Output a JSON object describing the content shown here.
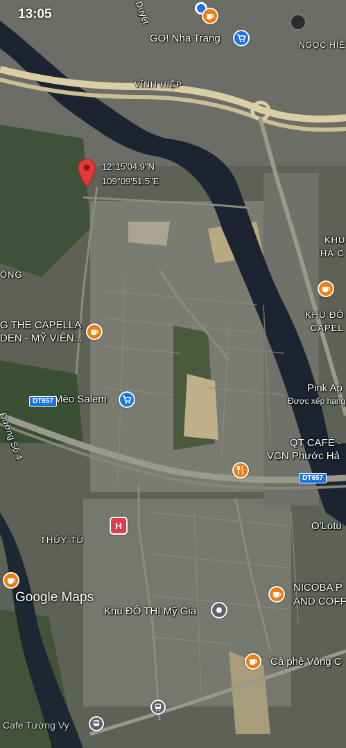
{
  "status_bar": {
    "time": "13:05"
  },
  "colors": {
    "river": "#1b2430",
    "highway": "#d9cfa3",
    "road": "#9a9a8c",
    "food_poi": "#f07d12",
    "shop_poi": "#1a73e8",
    "hospital_poi": "#e53950",
    "pin": "#e53935",
    "shield": "#1a73e8"
  },
  "pin": {
    "lat": "12°15'04.9\"N",
    "lon": "109°09'51.5\"E"
  },
  "labels": {
    "duyet": "Duyệt",
    "go_nha_trang": "GO! Nha Trang",
    "ngoc_hie": "NGỌC HIỆ",
    "vinh_hiep": "VĨNH HIỆP",
    "khu_ha": "KHU",
    "khu_ha_2": "HÀ C",
    "ong": "ÒNG",
    "capella_1": "G THE CAPELLA",
    "capella_2": "DEN - MỸ VIÊN...",
    "khu_do_1": "KHU ĐÔ",
    "khu_do_2": "CAPEL",
    "meo_salem": "Mèo Salem",
    "pink_ap": "Pink Ap",
    "duoc_xep_hang": "Được xếp hạng",
    "qt_cafe_1": "QT CAFÉ -",
    "qt_cafe_2": "VCN Phước Hả",
    "duong_so_4": "Đường Số 4",
    "thuy_tu": "THỦY TÚ",
    "o_lotu": "O'Lotu",
    "nicoba_1": "NICOBA P",
    "nicoba_2": "AND COFF",
    "khu_do_thi_my_gia": "Khu ĐÔ THỊ Mỹ Gia",
    "ca_phe_vong": "Cà phê Võng C",
    "bottom_left": "Cafe Tường Vy"
  },
  "shields": {
    "dt657_left": "DT657",
    "dt657_right": "DT657"
  },
  "poi_icons": {
    "food": "cup-icon",
    "shop": "cart-icon",
    "hospital": "H",
    "restaurant": "fork-icon",
    "transit": "bus-icon"
  },
  "google": {
    "logo": "Google Maps"
  }
}
